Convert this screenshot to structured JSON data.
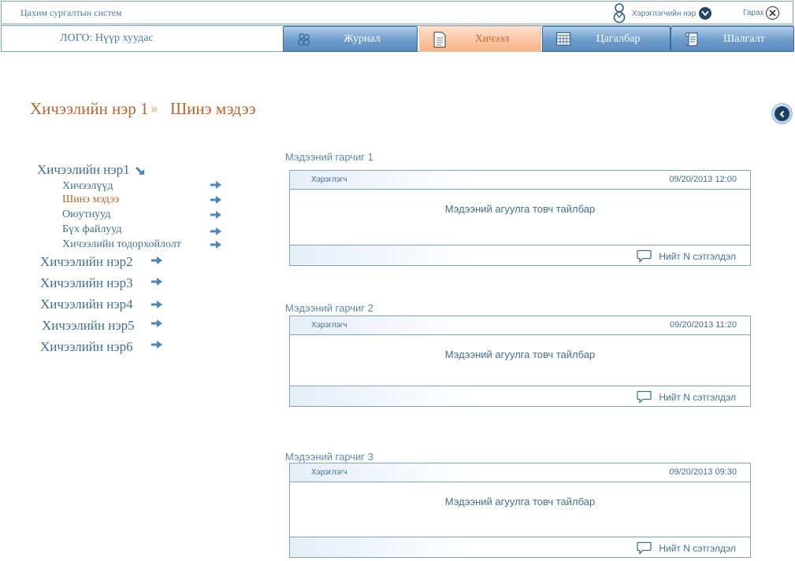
{
  "header": {
    "system_title": "Цахим сургалтын систем",
    "user_name": "Хэрэглэгчийн нэр",
    "logout_label": "Гарах",
    "logo_text": "ЛОГО: Нүүр хуудас"
  },
  "nav": {
    "tabs": [
      {
        "label": "Журнал",
        "icon": "people-icon",
        "active": false
      },
      {
        "label": "Хичээл",
        "icon": "document-icon",
        "active": true
      },
      {
        "label": "Цагалбар",
        "icon": "calendar-icon",
        "active": false
      },
      {
        "label": "Шалгалт",
        "icon": "scroll-icon",
        "active": false
      }
    ]
  },
  "breadcrumb": {
    "course": "Хичээлийн нэр 1",
    "separator": "»",
    "page": "Шинэ мэдээ"
  },
  "sidebar": {
    "lessons": [
      {
        "label": "Хичээлийн нэр1",
        "expanded": true,
        "subitems": [
          {
            "label": "Хичээлүүд"
          },
          {
            "label": "Шинэ мэдээ",
            "active": true
          },
          {
            "label": "Оюутнууд"
          },
          {
            "label": "Бүх файлууд"
          },
          {
            "label": "Хичээлийн тодорхойлолт"
          }
        ]
      },
      {
        "label": "Хичээлийн нэр2"
      },
      {
        "label": "Хичээлийн нэр3"
      },
      {
        "label": "Хичээлийн нэр4"
      },
      {
        "label": "Хичээлийн нэр5"
      },
      {
        "label": "Хичээлийн нэр6"
      }
    ]
  },
  "news": [
    {
      "title": "Мэдээний гарчиг 1",
      "author": "Хэрэглэгч",
      "date": "09/20/2013 12:00",
      "summary": "Мэдээний агуулга товч тайлбар",
      "comments": "Нийт N сэтгэлдэл"
    },
    {
      "title": "Мэдээний гарчиг 2",
      "author": "Хэрэглэгч",
      "date": "09/20/2013 11:20",
      "summary": "Мэдээний агуулга товч тайлбар",
      "comments": "Нийт N сэтгэлдэл"
    },
    {
      "title": "Мэдээний гарчиг 3",
      "author": "Хэрэглэгч",
      "date": "09/20/2013 09:30",
      "summary": "Мэдээний агуулга товч тайлбар",
      "comments": "Нийт N сэтгэлдэл"
    }
  ],
  "colors": {
    "accent_blue": "#3f6f97",
    "accent_orange": "#c0612a",
    "border": "#7fa5c5"
  }
}
